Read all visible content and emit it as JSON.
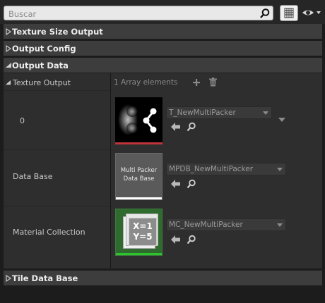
{
  "search": {
    "placeholder": "Buscar"
  },
  "categories": {
    "texture_size_output": "Texture Size Output",
    "output_config": "Output Config",
    "output_data": "Output Data",
    "tile_data_base": "Tile Data Base"
  },
  "texture_output": {
    "label": "Texture Output",
    "array_count": "1 Array elements",
    "element_index": "0",
    "asset": "T_NewMultiPacker"
  },
  "data_base": {
    "label": "Data Base",
    "thumb_line1": "Multi Packer",
    "thumb_line2": "Data Base",
    "asset": "MPDB_NewMultiPacker"
  },
  "material_collection": {
    "label": "Material Collection",
    "thumb_x": "X=1",
    "thumb_y": "Y=5",
    "asset": "MC_NewMultiPacker"
  },
  "colors": {
    "texture_stripe": "#c0343a",
    "database_stripe": "#ffffff",
    "collection_stripe": "#2ec42e"
  }
}
